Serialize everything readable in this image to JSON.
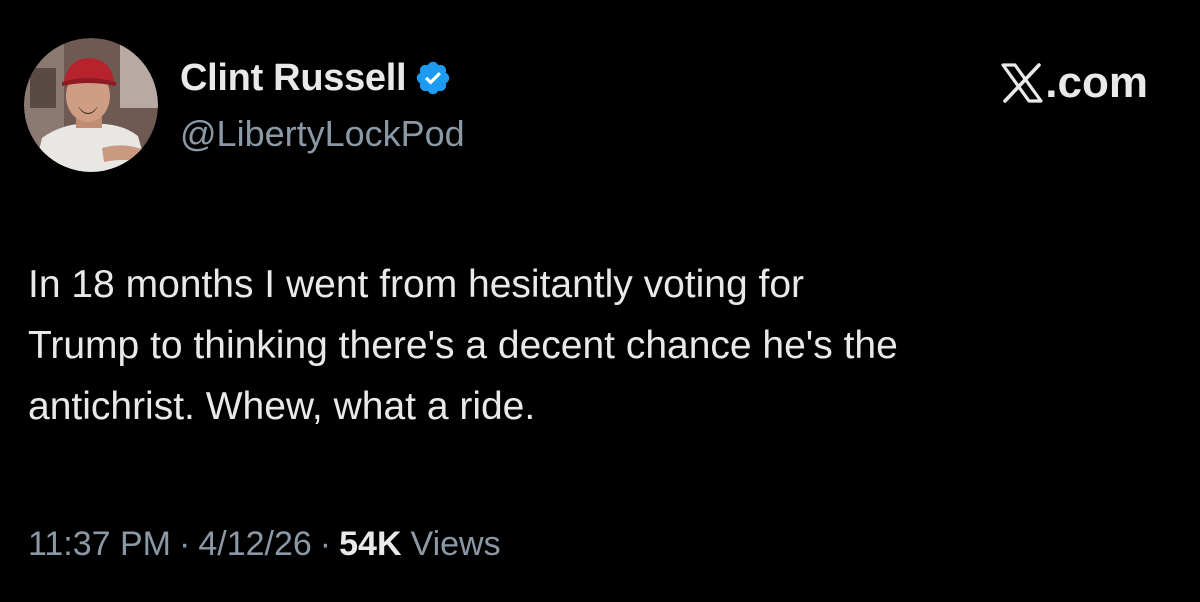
{
  "author": {
    "display_name": "Clint Russell",
    "handle": "@LibertyLockPod",
    "verified_icon": "verified-badge-icon",
    "avatar_icon": "profile-photo"
  },
  "brand": {
    "label": ".com",
    "logo_icon": "x-logo-icon"
  },
  "tweet": {
    "text": "In 18 months I went from hesitantly voting for\nTrump to thinking there's a decent chance he's the\nantichrist. Whew, what a ride."
  },
  "meta": {
    "time": "11:37 PM",
    "separator": "·",
    "date": "4/12/26",
    "views_count": "54K",
    "views_label": "Views"
  },
  "colors": {
    "background": "#000000",
    "primary_text": "#e7e9ea",
    "secondary_text": "#8b98a5",
    "verified_blue": "#1d9bf0"
  }
}
